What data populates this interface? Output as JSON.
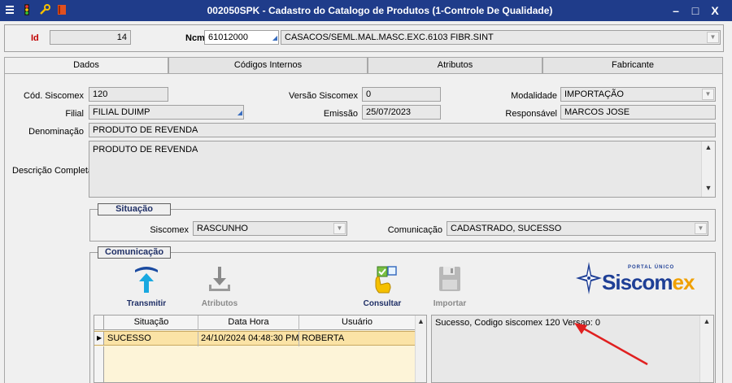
{
  "window": {
    "title": "002050SPK - Cadastro do Catalogo de Produtos (1-Controle De Qualidade)",
    "minimize": "–",
    "maximize": "□",
    "close": "X"
  },
  "header": {
    "id_label": "Id",
    "id_value": "14",
    "ncm_label": "Ncm",
    "ncm_code": "61012000",
    "ncm_description": "CASACOS/SEML.MAL.MASC.EXC.6103 FIBR.SINT"
  },
  "tabs": [
    {
      "label": "Dados",
      "active": true
    },
    {
      "label": "Códigos Internos",
      "active": false
    },
    {
      "label": "Atributos",
      "active": false
    },
    {
      "label": "Fabricante",
      "active": false
    }
  ],
  "form": {
    "cod_siscomex_label": "Cód. Siscomex",
    "cod_siscomex_value": "120",
    "versao_label": "Versão Siscomex",
    "versao_value": "0",
    "modalidade_label": "Modalidade",
    "modalidade_value": "IMPORTAÇÃO",
    "filial_label": "Filial",
    "filial_value": "FILIAL DUIMP",
    "emissao_label": "Emissão",
    "emissao_value": "25/07/2023",
    "responsavel_label": "Responsável",
    "responsavel_value": "MARCOS JOSE",
    "denominacao_label": "Denominação",
    "denominacao_value": "PRODUTO DE REVENDA",
    "descricao_label": "Descrição Completa",
    "descricao_value": "PRODUTO DE REVENDA"
  },
  "situacao": {
    "title": "Situação",
    "siscomex_label": "Siscomex",
    "siscomex_value": "RASCUNHO",
    "comunicacao_label": "Comunicação",
    "comunicacao_value": "CADASTRADO, SUCESSO"
  },
  "comunicacao": {
    "title": "Comunicação",
    "buttons": {
      "transmitir": "Transmitir",
      "atributos": "Atributos",
      "consultar": "Consultar",
      "importar": "Importar"
    },
    "logo": {
      "portal": "PORTAL ÚNICO",
      "word_main": "Siscom",
      "word_accent": "ex"
    },
    "grid": {
      "columns": [
        "Situação",
        "Data Hora",
        "Usuário"
      ],
      "rows": [
        {
          "situacao": "SUCESSO",
          "data_hora": "24/10/2024 04:48:30 PM",
          "usuario": "ROBERTA"
        }
      ]
    },
    "message": "Sucesso, Codigo siscomex 120 Versao: 0"
  },
  "colors": {
    "titlebar": "#1f3c8a",
    "id_label": "#c00000",
    "grid_bg": "#fdf4d8",
    "selected_row": "#fbe3a6",
    "arrow": "#e02020",
    "logo_blue": "#1e3f96",
    "logo_orange": "#f0a000"
  }
}
